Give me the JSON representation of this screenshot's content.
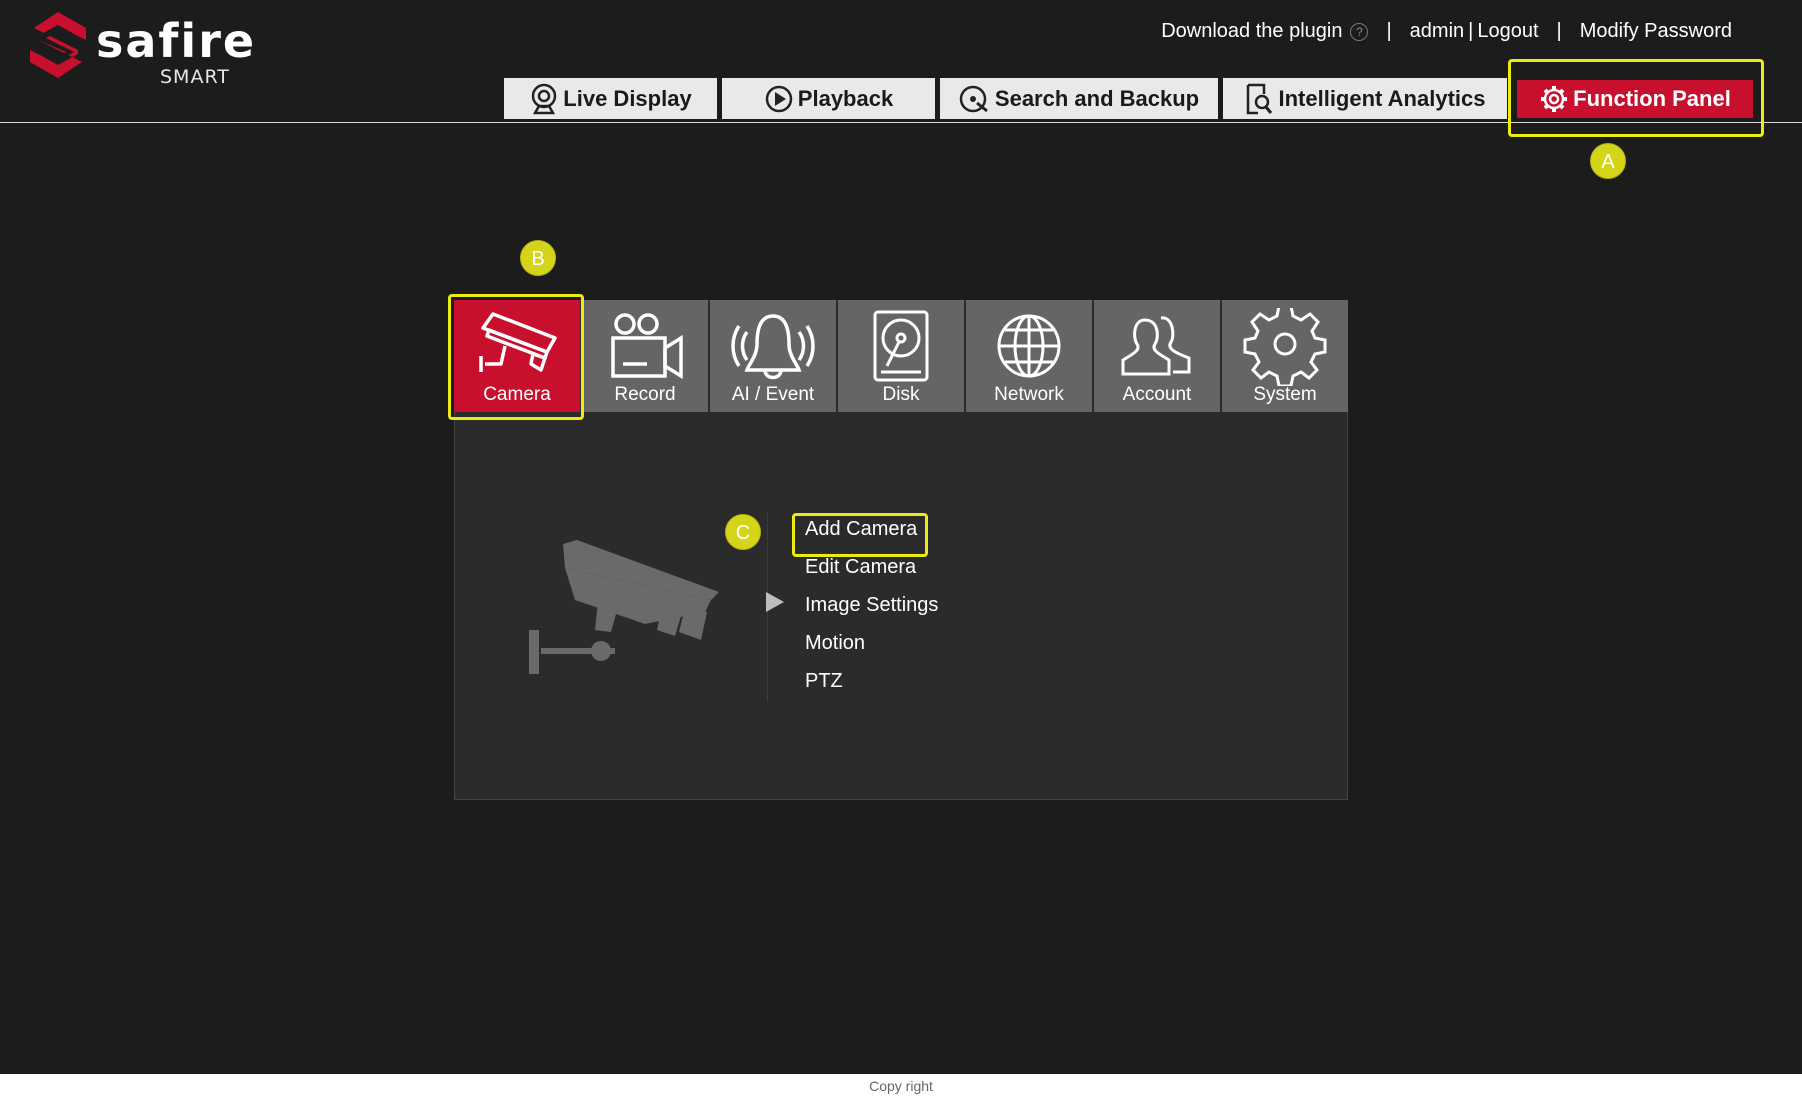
{
  "brand": {
    "name": "safire",
    "sub": "SMART",
    "color": "#c8102e"
  },
  "header": {
    "download_plugin": "Download the plugin",
    "help_glyph": "?",
    "sep": "|",
    "user": "admin",
    "user_sep": "|",
    "logout": "Logout",
    "modify_password": "Modify Password"
  },
  "nav": {
    "tabs": [
      {
        "label": "Live Display",
        "icon": "webcam-icon"
      },
      {
        "label": "Playback",
        "icon": "play-circle-icon"
      },
      {
        "label": "Search and Backup",
        "icon": "disc-search-icon"
      },
      {
        "label": "Intelligent Analytics",
        "icon": "document-search-icon"
      },
      {
        "label": "Function Panel",
        "icon": "gear-icon",
        "active": true
      }
    ]
  },
  "annotations": {
    "a": "A",
    "b": "B",
    "c": "C",
    "color": "#ecec13"
  },
  "modules": [
    {
      "label": "Camera",
      "icon": "cctv-camera-icon",
      "active": true
    },
    {
      "label": "Record",
      "icon": "video-camera-icon"
    },
    {
      "label": "AI / Event",
      "icon": "bell-icon"
    },
    {
      "label": "Disk",
      "icon": "hard-disk-icon"
    },
    {
      "label": "Network",
      "icon": "globe-icon"
    },
    {
      "label": "Account",
      "icon": "users-icon"
    },
    {
      "label": "System",
      "icon": "gear-icon"
    }
  ],
  "camera_menu": {
    "items": [
      "Add Camera",
      "Edit Camera",
      "Image Settings",
      "Motion",
      "PTZ"
    ],
    "highlighted": "Add Camera",
    "selected_arrow_at": "Image Settings"
  },
  "footer": {
    "text": "Copy right"
  }
}
